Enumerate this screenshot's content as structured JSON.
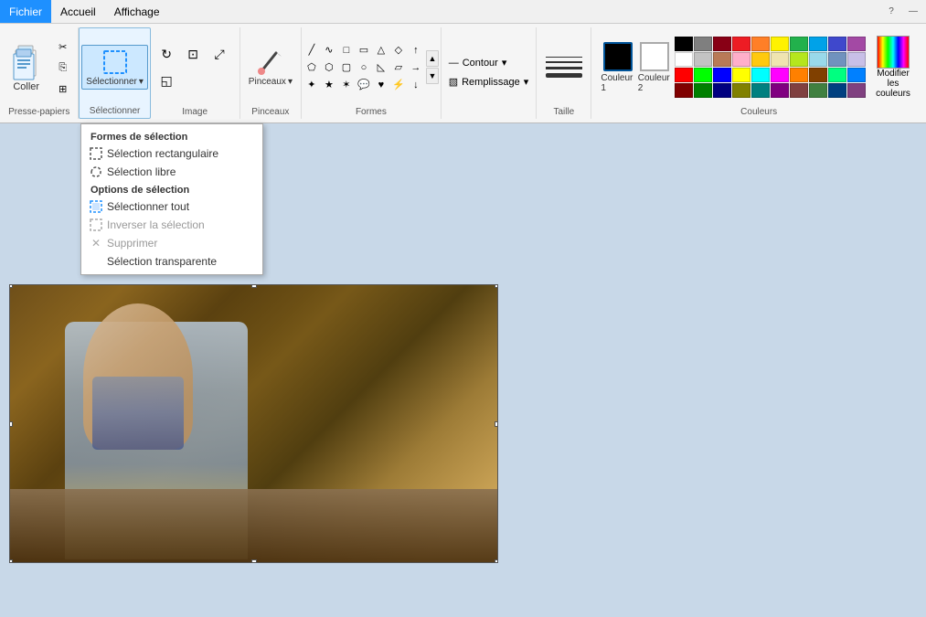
{
  "menubar": {
    "items": [
      {
        "id": "fichier",
        "label": "Fichier",
        "active": true
      },
      {
        "id": "accueil",
        "label": "Accueil",
        "active": false
      },
      {
        "id": "affichage",
        "label": "Affichage",
        "active": false
      }
    ]
  },
  "ribbon": {
    "groups": {
      "clipboard": {
        "label": "Presse-papiers",
        "paste": "Coller",
        "cut": "✂",
        "copy": "📋",
        "paste_small": "📋"
      },
      "select": {
        "label": "Sélectionner",
        "tool_label": "Sélectionner"
      },
      "image": {
        "label": "Image"
      },
      "brushes": {
        "label": "Pinceaux",
        "tool_label": "Pinceaux"
      },
      "shapes": {
        "label": "Formes"
      },
      "outline": {
        "label": "Contour",
        "fill_label": "Remplissage"
      },
      "size": {
        "label": "Taille"
      },
      "colors": {
        "label": "Couleurs",
        "color1_label": "Couleur 1",
        "color2_label": "Couleur 2",
        "modify_label": "Modifier les couleurs"
      }
    }
  },
  "dropdown": {
    "selection_forms_label": "Formes de sélection",
    "rectangular": "Sélection rectangulaire",
    "free": "Sélection libre",
    "options_label": "Options de sélection",
    "select_all": "Sélectionner tout",
    "invert": "Inverser la sélection",
    "delete": "Supprimer",
    "transparent": "Sélection transparente"
  },
  "colors": {
    "color1": "#000000",
    "color2": "#ffffff",
    "palette": [
      "#000000",
      "#7f7f7f",
      "#880015",
      "#ed1c24",
      "#ff7f27",
      "#fff200",
      "#22b14c",
      "#00a2e8",
      "#3f48cc",
      "#a349a4",
      "#ffffff",
      "#c3c3c3",
      "#b97a57",
      "#ffaec9",
      "#ffc90e",
      "#efe4b0",
      "#b5e61d",
      "#99d9ea",
      "#7092be",
      "#c8bfe7",
      "#ff0000",
      "#00ff00",
      "#0000ff",
      "#ffff00",
      "#00ffff",
      "#ff00ff",
      "#ff8000",
      "#804000",
      "#00ff80",
      "#0080ff",
      "#800000",
      "#008000",
      "#000080",
      "#808000",
      "#008080",
      "#800080",
      "#804040",
      "#408040",
      "#004080",
      "#804080"
    ]
  },
  "status": ""
}
